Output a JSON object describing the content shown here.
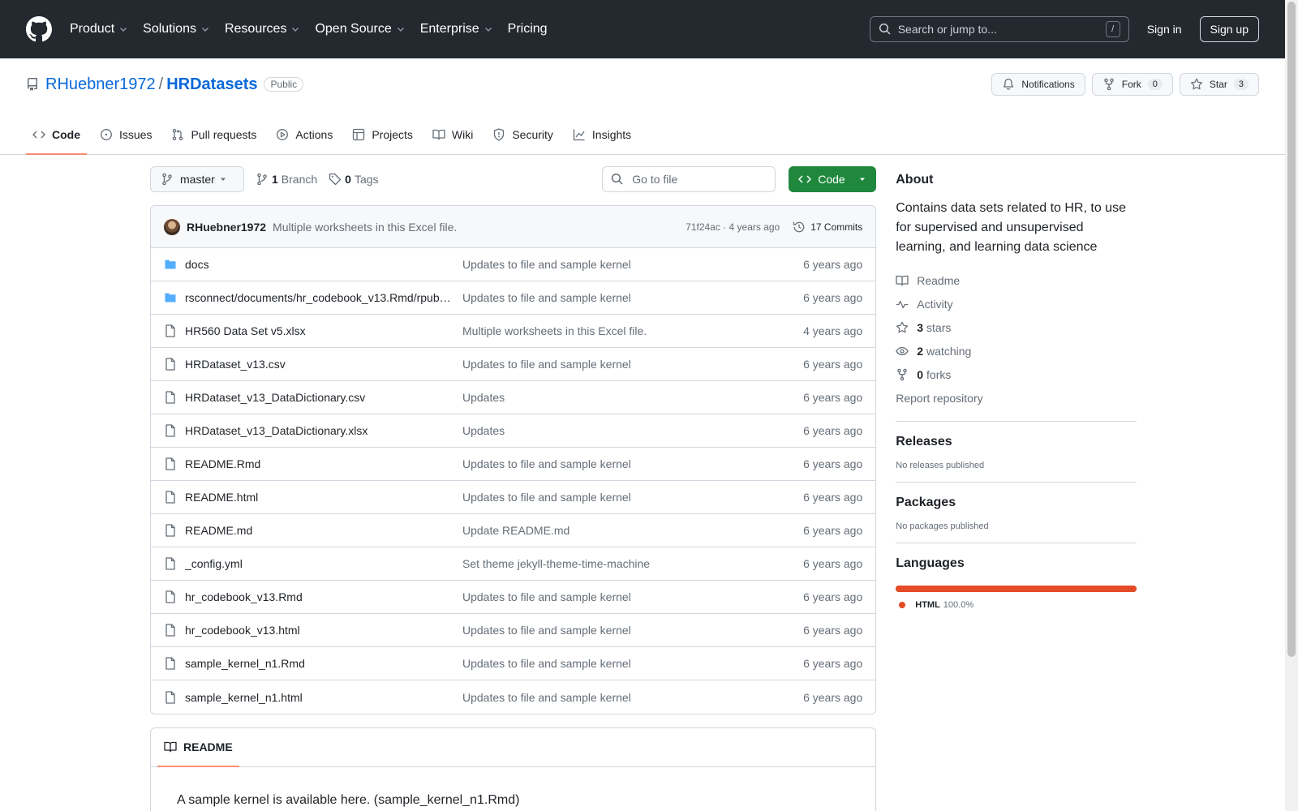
{
  "header": {
    "nav": [
      "Product",
      "Solutions",
      "Resources",
      "Open Source",
      "Enterprise",
      "Pricing"
    ],
    "search_placeholder": "Search or jump to...",
    "search_shortcut": "/",
    "sign_in": "Sign in",
    "sign_up": "Sign up"
  },
  "repo": {
    "owner": "RHuebner1972",
    "separator": "/",
    "name": "HRDatasets",
    "visibility": "Public",
    "notifications_label": "Notifications",
    "fork_label": "Fork",
    "fork_count": "0",
    "star_label": "Star",
    "star_count": "3",
    "tabs": [
      "Code",
      "Issues",
      "Pull requests",
      "Actions",
      "Projects",
      "Wiki",
      "Security",
      "Insights"
    ]
  },
  "file_nav": {
    "branch": "master",
    "branch_count": "1",
    "branch_label": "Branch",
    "tag_count": "0",
    "tag_label": "Tags",
    "goto_placeholder": "Go to file",
    "code_button": "Code"
  },
  "latest_commit": {
    "author": "RHuebner1972",
    "message": "Multiple worksheets in this Excel file.",
    "sha_age": "71f24ac · 4 years ago",
    "commits": "17 Commits"
  },
  "files": [
    {
      "name": "docs",
      "type": "dir",
      "commit": "Updates to file and sample kernel",
      "age": "6 years ago"
    },
    {
      "name": "rsconnect/documents/hr_codebook_v13.Rmd/rpubs.com/rpubs",
      "type": "dir",
      "commit": "Updates to file and sample kernel",
      "age": "6 years ago"
    },
    {
      "name": "HR560 Data Set v5.xlsx",
      "type": "file",
      "commit": "Multiple worksheets in this Excel file.",
      "age": "4 years ago"
    },
    {
      "name": "HRDataset_v13.csv",
      "type": "file",
      "commit": "Updates to file and sample kernel",
      "age": "6 years ago"
    },
    {
      "name": "HRDataset_v13_DataDictionary.csv",
      "type": "file",
      "commit": "Updates",
      "age": "6 years ago"
    },
    {
      "name": "HRDataset_v13_DataDictionary.xlsx",
      "type": "file",
      "commit": "Updates",
      "age": "6 years ago"
    },
    {
      "name": "README.Rmd",
      "type": "file",
      "commit": "Updates to file and sample kernel",
      "age": "6 years ago"
    },
    {
      "name": "README.html",
      "type": "file",
      "commit": "Updates to file and sample kernel",
      "age": "6 years ago"
    },
    {
      "name": "README.md",
      "type": "file",
      "commit": "Update README.md",
      "age": "6 years ago"
    },
    {
      "name": "_config.yml",
      "type": "file",
      "commit": "Set theme jekyll-theme-time-machine",
      "age": "6 years ago"
    },
    {
      "name": "hr_codebook_v13.Rmd",
      "type": "file",
      "commit": "Updates to file and sample kernel",
      "age": "6 years ago"
    },
    {
      "name": "hr_codebook_v13.html",
      "type": "file",
      "commit": "Updates to file and sample kernel",
      "age": "6 years ago"
    },
    {
      "name": "sample_kernel_n1.Rmd",
      "type": "file",
      "commit": "Updates to file and sample kernel",
      "age": "6 years ago"
    },
    {
      "name": "sample_kernel_n1.html",
      "type": "file",
      "commit": "Updates to file and sample kernel",
      "age": "6 years ago"
    }
  ],
  "readme": {
    "tab": "README",
    "first_line": "A sample kernel is available here. (sample_kernel_n1.Rmd)"
  },
  "about": {
    "title": "About",
    "description": "Contains data sets related to HR, to use for supervised and unsupervised learning, and learning data science",
    "readme": "Readme",
    "activity": "Activity",
    "stars_count": "3",
    "stars_label": "stars",
    "watching_count": "2",
    "watching_label": "watching",
    "forks_count": "0",
    "forks_label": "forks",
    "report": "Report repository"
  },
  "releases": {
    "title": "Releases",
    "empty": "No releases published"
  },
  "packages": {
    "title": "Packages",
    "empty": "No packages published"
  },
  "languages": {
    "title": "Languages",
    "items": [
      {
        "name": "HTML",
        "percent": "100.0%",
        "share": 1.0,
        "color": "#e34c26"
      }
    ]
  }
}
